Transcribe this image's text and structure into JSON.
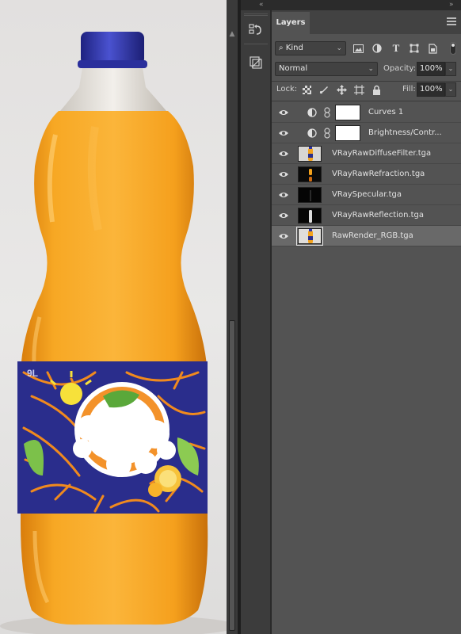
{
  "topstrip": {
    "collapse_left": "«",
    "collapse_right": "»"
  },
  "panel": {
    "tab_label": "Layers",
    "filter": {
      "kind_label": "Kind"
    },
    "blend": {
      "mode": "Normal",
      "opacity_label": "Opacity:",
      "opacity_value": "100%"
    },
    "lock": {
      "label": "Lock:",
      "fill_label": "Fill:",
      "fill_value": "100%"
    }
  },
  "layers": [
    {
      "name": "Curves 1",
      "type": "adjustment",
      "adjust_icon": "curves-icon",
      "visible": true,
      "selected": false
    },
    {
      "name": "Brightness/Contr...",
      "type": "adjustment",
      "adjust_icon": "brightness-icon",
      "visible": true,
      "selected": false
    },
    {
      "name": "VRayRawDiffuseFilter.tga",
      "type": "pixel",
      "thumb": "diffuse",
      "visible": true,
      "selected": false
    },
    {
      "name": "VRayRawRefraction.tga",
      "type": "pixel",
      "thumb": "refraction",
      "visible": true,
      "selected": false
    },
    {
      "name": "VRaySpecular.tga",
      "type": "pixel",
      "thumb": "specular",
      "visible": true,
      "selected": false
    },
    {
      "name": "VRayRawReflection.tga",
      "type": "pixel",
      "thumb": "reflection",
      "visible": true,
      "selected": false
    },
    {
      "name": "RawRender_RGB.tga",
      "type": "pixel",
      "thumb": "raw",
      "visible": true,
      "selected": true
    }
  ],
  "colors": {
    "panel_bg": "#535353",
    "selected_row": "#696969",
    "bottle_cap": "#2f35a8",
    "liquid": "#f3a21c",
    "label_blue": "#2a2d8c",
    "label_orange": "#f08a1e"
  }
}
